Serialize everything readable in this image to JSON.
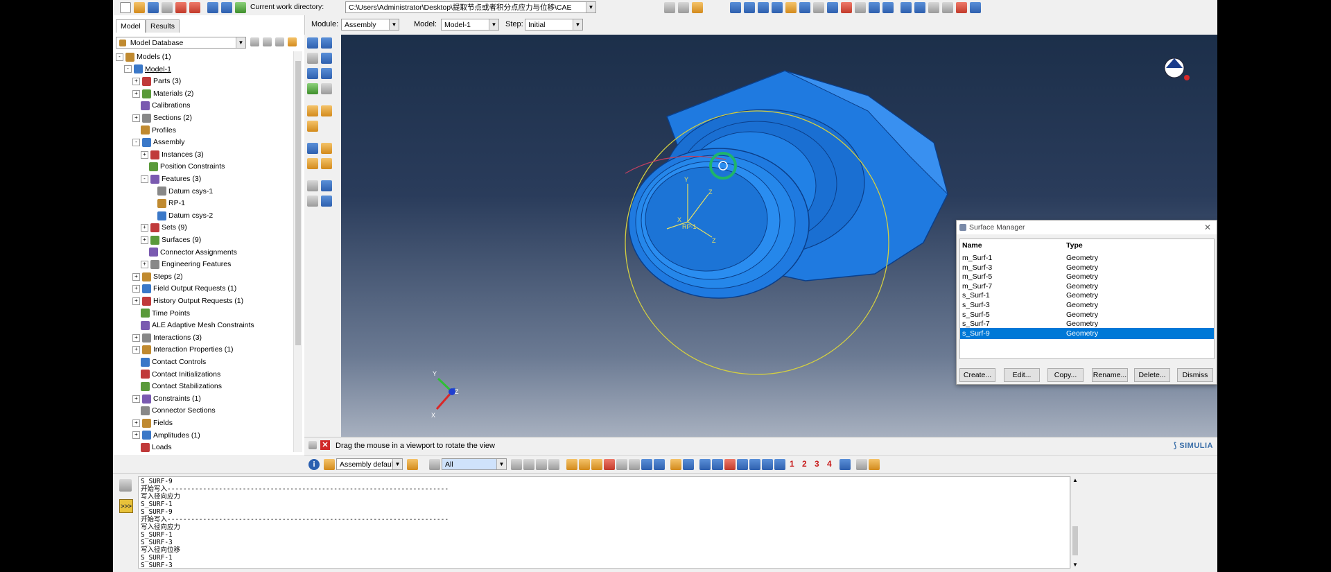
{
  "toolbar": {
    "work_dir_label": "Current work directory:",
    "work_dir_value": "C:\\Users\\Administrator\\Desktop\\提取节点或者积分点应力与位移\\CAE",
    "module_label": "Module:",
    "module_value": "Assembly",
    "model_label": "Model:",
    "model_value": "Model-1",
    "step_label": "Step:",
    "step_value": "Initial"
  },
  "left_panel": {
    "tabs": [
      "Model",
      "Results"
    ],
    "active_tab": "Model",
    "database": "Model Database",
    "tree": [
      {
        "label": "Models (1)",
        "level": 0,
        "exp": "-"
      },
      {
        "label": "Model-1",
        "level": 1,
        "exp": "-"
      },
      {
        "label": "Parts (3)",
        "level": 2,
        "exp": "+"
      },
      {
        "label": "Materials (2)",
        "level": 2,
        "exp": "+"
      },
      {
        "label": "Calibrations",
        "level": 2,
        "exp": ""
      },
      {
        "label": "Sections (2)",
        "level": 2,
        "exp": "+"
      },
      {
        "label": "Profiles",
        "level": 2,
        "exp": ""
      },
      {
        "label": "Assembly",
        "level": 2,
        "exp": "-"
      },
      {
        "label": "Instances (3)",
        "level": 3,
        "exp": "+"
      },
      {
        "label": "Position Constraints",
        "level": 3,
        "exp": ""
      },
      {
        "label": "Features (3)",
        "level": 3,
        "exp": "-"
      },
      {
        "label": "Datum csys-1",
        "level": 4,
        "exp": ""
      },
      {
        "label": "RP-1",
        "level": 4,
        "exp": ""
      },
      {
        "label": "Datum csys-2",
        "level": 4,
        "exp": ""
      },
      {
        "label": "Sets (9)",
        "level": 3,
        "exp": "+"
      },
      {
        "label": "Surfaces (9)",
        "level": 3,
        "exp": "+"
      },
      {
        "label": "Connector Assignments",
        "level": 3,
        "exp": ""
      },
      {
        "label": "Engineering Features",
        "level": 3,
        "exp": "+"
      },
      {
        "label": "Steps (2)",
        "level": 2,
        "exp": "+"
      },
      {
        "label": "Field Output Requests (1)",
        "level": 2,
        "exp": "+"
      },
      {
        "label": "History Output Requests (1)",
        "level": 2,
        "exp": "+"
      },
      {
        "label": "Time Points",
        "level": 2,
        "exp": ""
      },
      {
        "label": "ALE Adaptive Mesh Constraints",
        "level": 2,
        "exp": ""
      },
      {
        "label": "Interactions (3)",
        "level": 2,
        "exp": "+"
      },
      {
        "label": "Interaction Properties (1)",
        "level": 2,
        "exp": "+"
      },
      {
        "label": "Contact Controls",
        "level": 2,
        "exp": ""
      },
      {
        "label": "Contact Initializations",
        "level": 2,
        "exp": ""
      },
      {
        "label": "Contact Stabilizations",
        "level": 2,
        "exp": ""
      },
      {
        "label": "Constraints (1)",
        "level": 2,
        "exp": "+"
      },
      {
        "label": "Connector Sections",
        "level": 2,
        "exp": ""
      },
      {
        "label": "Fields",
        "level": 2,
        "exp": "+"
      },
      {
        "label": "Amplitudes (1)",
        "level": 2,
        "exp": "+"
      },
      {
        "label": "Loads",
        "level": 2,
        "exp": ""
      }
    ]
  },
  "viewport": {
    "labels": {
      "y1": "Y",
      "z1": "Z",
      "rp1": "RP-1",
      "x1": "X",
      "y2": "Z",
      "z2": "Z"
    },
    "triad": {
      "y": "Y",
      "x": "X",
      "z": "Z"
    }
  },
  "surface_manager": {
    "title": "Surface Manager",
    "col_name": "Name",
    "col_type": "Type",
    "rows": [
      {
        "name": "m_Surf-1",
        "type": "Geometry"
      },
      {
        "name": "m_Surf-3",
        "type": "Geometry"
      },
      {
        "name": "m_Surf-5",
        "type": "Geometry"
      },
      {
        "name": "m_Surf-7",
        "type": "Geometry"
      },
      {
        "name": "s_Surf-1",
        "type": "Geometry"
      },
      {
        "name": "s_Surf-3",
        "type": "Geometry"
      },
      {
        "name": "s_Surf-5",
        "type": "Geometry"
      },
      {
        "name": "s_Surf-7",
        "type": "Geometry"
      },
      {
        "name": "s_Surf-9",
        "type": "Geometry"
      }
    ],
    "selected": "s_Surf-9",
    "buttons": [
      "Create...",
      "Edit...",
      "Copy...",
      "Rename...",
      "Delete...",
      "Dismiss"
    ]
  },
  "prompt": {
    "text": "Drag the mouse in a viewport to rotate the view",
    "brand": "SIMULIA"
  },
  "bottom_toolbar": {
    "render_style": "Assembly defaults",
    "selection_filter": "All",
    "numbers": [
      "1",
      "2",
      "3",
      "4"
    ]
  },
  "message_area": {
    "lines": [
      "S_SURF-9",
      "开始写入-----------------------------------------------------------------------",
      "写入径向应力",
      "S_SURF-1",
      "S_SURF-9",
      "开始写入-----------------------------------------------------------------------",
      "写入径向应力",
      "S_SURF-1",
      "S_SURF-3",
      "写入径向位移",
      "S_SURF-1",
      "S_SURF-3"
    ]
  }
}
